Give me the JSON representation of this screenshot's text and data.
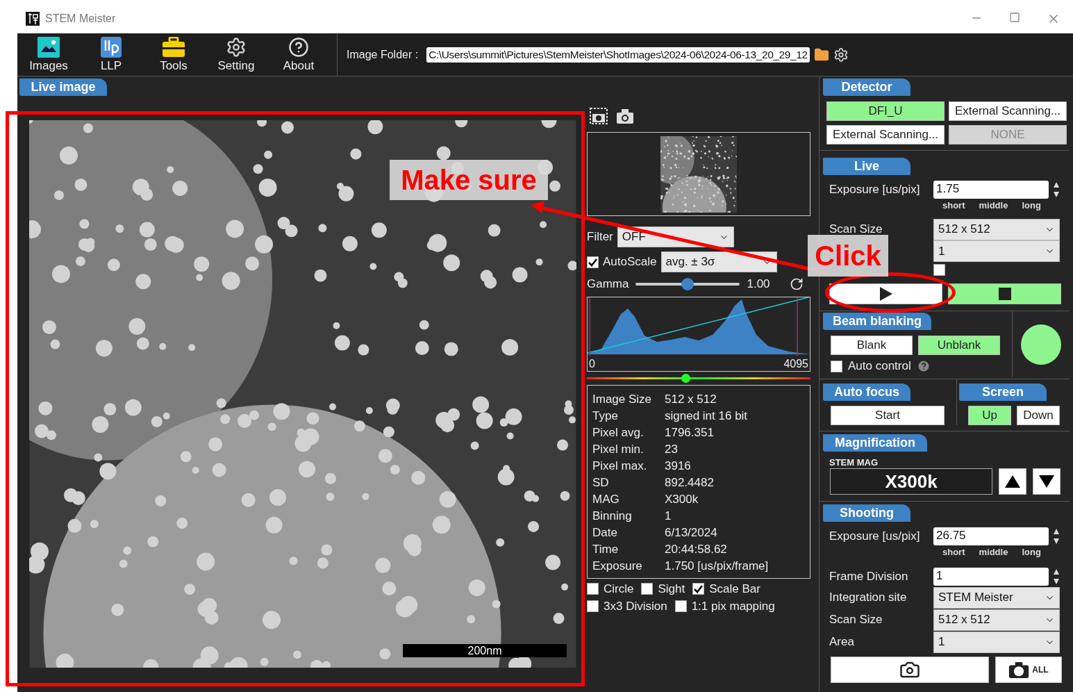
{
  "window": {
    "title": "STEM Meister"
  },
  "toolbar": [
    {
      "label": "Images",
      "kind": "images"
    },
    {
      "label": "LLP",
      "kind": "llp"
    },
    {
      "label": "Tools",
      "kind": "tools"
    },
    {
      "label": "Setting",
      "kind": "setting"
    },
    {
      "label": "About",
      "kind": "about"
    }
  ],
  "image_folder": {
    "label": "Image Folder :",
    "value": "C:\\Users\\summit\\Pictures\\StemMeister\\ShotImages\\2024-06\\2024-06-13_20_29_12"
  },
  "live_image": {
    "title": "Live image",
    "scale_bar": "200nm"
  },
  "display": {
    "filter": {
      "label": "Filter",
      "value": "OFF"
    },
    "autoscale": {
      "label": "AutoScale",
      "checked": true,
      "value": "avg. ± 3σ"
    },
    "gamma": {
      "label": "Gamma",
      "level": 0.5,
      "reading": "1.00"
    },
    "histogram": {
      "min_label": "0",
      "max_label": "4095"
    },
    "range_slider": {
      "level": 0.44
    }
  },
  "info": [
    {
      "label": "Image Size",
      "value": "512 x 512"
    },
    {
      "label": "Type",
      "value": "signed int 16 bit"
    },
    {
      "label": "Pixel avg.",
      "value": "1796.351"
    },
    {
      "label": "Pixel min.",
      "value": "23"
    },
    {
      "label": "Pixel max.",
      "value": "3916"
    },
    {
      "label": "SD",
      "value": "892.4482"
    },
    {
      "label": "MAG",
      "value": "X300k"
    },
    {
      "label": "Binning",
      "value": "1"
    },
    {
      "label": "Date",
      "value": "6/13/2024"
    },
    {
      "label": "Time",
      "value": "20:44:58.62"
    },
    {
      "label": "Exposure",
      "value": "1.750 [us/pix/frame]"
    }
  ],
  "overlay_options": [
    [
      {
        "label": "Circle",
        "checked": false
      },
      {
        "label": "Sight",
        "checked": false
      },
      {
        "label": "Scale Bar",
        "checked": true
      }
    ],
    [
      {
        "label": "3x3 Division",
        "checked": false
      },
      {
        "label": "1:1 pix mapping",
        "checked": false
      }
    ]
  ],
  "detector": {
    "title": "Detector",
    "options": [
      {
        "label": "DFI_U",
        "selected": true,
        "disabled": false
      },
      {
        "label": "External Scanning...",
        "selected": false,
        "disabled": false
      },
      {
        "label": "External Scanning...",
        "selected": false,
        "disabled": false
      },
      {
        "label": "NONE",
        "selected": false,
        "disabled": true
      }
    ]
  },
  "live": {
    "title": "Live",
    "exposure": {
      "label": "Exposure [us/pix]",
      "value": "1.75"
    },
    "presets": [
      "short",
      "middle",
      "long"
    ],
    "scan_size": {
      "label": "Scan Size",
      "value": "512 x 512"
    },
    "area": {
      "value": "1"
    },
    "fft": {
      "checked": false
    },
    "controls": [
      {
        "kind": "play",
        "active": false
      },
      {
        "kind": "stop",
        "active": true
      }
    ]
  },
  "beam_blanking": {
    "title": "Beam blanking",
    "options": [
      {
        "label": "Blank",
        "selected": false
      },
      {
        "label": "Unblank",
        "selected": true
      }
    ],
    "beam_on": true,
    "auto_control": {
      "label": "Auto control",
      "checked": false
    }
  },
  "auto_focus": {
    "title": "Auto focus",
    "button": "Start"
  },
  "screen": {
    "title": "Screen",
    "options": [
      {
        "label": "Up",
        "selected": true
      },
      {
        "label": "Down",
        "selected": false
      }
    ]
  },
  "magnification": {
    "title": "Magnification",
    "label": "STEM MAG",
    "value": "X300k"
  },
  "shooting": {
    "title": "Shooting",
    "exposure": {
      "label": "Exposure [us/pix]",
      "value": "26.75"
    },
    "presets": [
      "short",
      "middle",
      "long"
    ],
    "fields": [
      {
        "kind": "spin",
        "label": "Frame Division",
        "value": "1"
      },
      {
        "kind": "select",
        "label": "Integration site",
        "value": "STEM Meister"
      },
      {
        "kind": "select",
        "label": "Scan Size",
        "value": "512 x 512"
      },
      {
        "kind": "select",
        "label": "Area",
        "value": "1"
      }
    ],
    "all_label": "ALL"
  },
  "annotations": [
    {
      "kind": "target",
      "text": "Make sure"
    },
    {
      "kind": "action",
      "text": "Click"
    }
  ]
}
